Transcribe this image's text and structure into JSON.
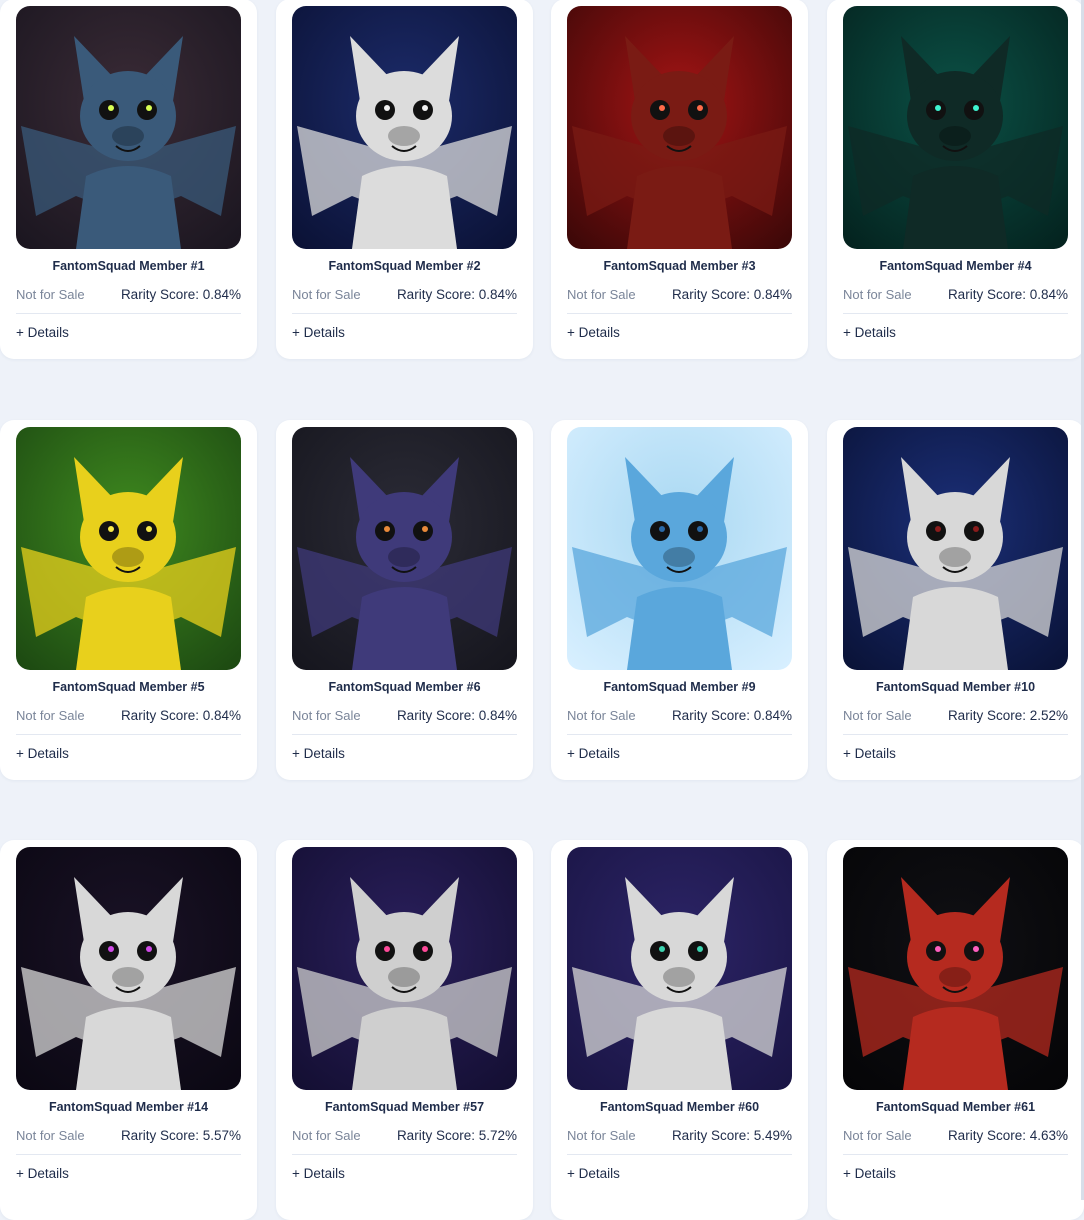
{
  "cards": [
    {
      "title": "FantomSquad Member #1",
      "sale": "Not for Sale",
      "rarity": "Rarity Score: 0.84%",
      "details": "+ Details",
      "bg": "#3a2b36",
      "bg2": "#1b1620",
      "bat": "#3a5a7a",
      "accent": "#d9ff54"
    },
    {
      "title": "FantomSquad Member #2",
      "sale": "Not for Sale",
      "rarity": "Rarity Score: 0.84%",
      "details": "+ Details",
      "bg": "#1c2b6a",
      "bg2": "#0b1236",
      "bat": "#dcdcdc",
      "accent": "#f2f2f2"
    },
    {
      "title": "FantomSquad Member #3",
      "sale": "Not for Sale",
      "rarity": "Rarity Score: 0.84%",
      "details": "+ Details",
      "bg": "#a41414",
      "bg2": "#3d0808",
      "bat": "#7a1b14",
      "accent": "#ff6b4a"
    },
    {
      "title": "FantomSquad Member #4",
      "sale": "Not for Sale",
      "rarity": "Rarity Score: 0.84%",
      "details": "+ Details",
      "bg": "#0b5146",
      "bg2": "#04231f",
      "bat": "#0f2a26",
      "accent": "#3ff3d0"
    },
    {
      "title": "FantomSquad Member #5",
      "sale": "Not for Sale",
      "rarity": "Rarity Score: 0.84%",
      "details": "+ Details",
      "bg": "#3f8a1f",
      "bg2": "#1d4a12",
      "bat": "#e8d01c",
      "accent": "#f7ea4a"
    },
    {
      "title": "FantomSquad Member #6",
      "sale": "Not for Sale",
      "rarity": "Rarity Score: 0.84%",
      "details": "+ Details",
      "bg": "#2b2b36",
      "bg2": "#16161e",
      "bat": "#3f3a7a",
      "accent": "#e98a3a"
    },
    {
      "title": "FantomSquad Member #9",
      "sale": "Not for Sale",
      "rarity": "Rarity Score: 0.84%",
      "details": "+ Details",
      "bg": "#a9d8f2",
      "bg2": "#d7efff",
      "bat": "#5aa7dc",
      "accent": "#2a6aa8"
    },
    {
      "title": "FantomSquad Member #10",
      "sale": "Not for Sale",
      "rarity": "Rarity Score: 2.52%",
      "details": "+ Details",
      "bg": "#1b2f78",
      "bg2": "#0a1338",
      "bat": "#d8d8d8",
      "accent": "#8a1c1c"
    },
    {
      "title": "FantomSquad Member #14",
      "sale": "Not for Sale",
      "rarity": "Rarity Score: 5.57%",
      "details": "+ Details",
      "bg": "#1a1226",
      "bg2": "#0b0813",
      "bat": "#d8d8d8",
      "accent": "#d14be8"
    },
    {
      "title": "FantomSquad Member #57",
      "sale": "Not for Sale",
      "rarity": "Rarity Score: 5.72%",
      "details": "+ Details",
      "bg": "#2a1f5c",
      "bg2": "#140f33",
      "bat": "#cfcfcf",
      "accent": "#ff4a9a"
    },
    {
      "title": "FantomSquad Member #60",
      "sale": "Not for Sale",
      "rarity": "Rarity Score: 5.49%",
      "details": "+ Details",
      "bg": "#2c2466",
      "bg2": "#1a1545",
      "bat": "#d8d8d8",
      "accent": "#3cd4b0"
    },
    {
      "title": "FantomSquad Member #61",
      "sale": "Not for Sale",
      "rarity": "Rarity Score: 4.63%",
      "details": "+ Details",
      "bg": "#101014",
      "bg2": "#050507",
      "bat": "#b52a1f",
      "accent": "#ff5fbf"
    }
  ],
  "icons": {
    "art": "bat-avatar-icon"
  },
  "colors": {
    "page_bg": "#eef2f9",
    "card_bg": "#ffffff",
    "text_dark": "#1f2c4a",
    "text_muted": "#7a8599"
  }
}
